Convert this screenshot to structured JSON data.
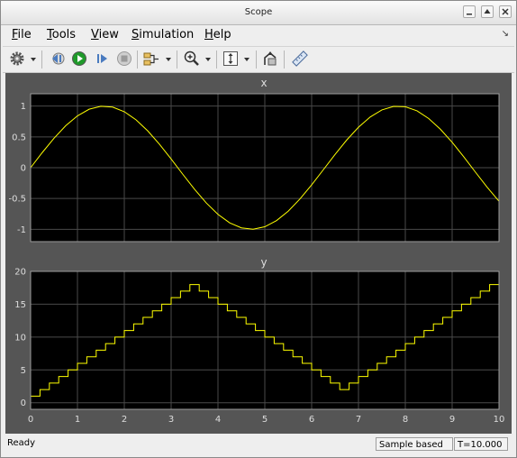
{
  "window": {
    "title": "Scope"
  },
  "menu": {
    "file": {
      "mnemonic": "F",
      "rest": "ile"
    },
    "tools": {
      "mnemonic": "T",
      "rest": "ools"
    },
    "view": {
      "mnemonic": "V",
      "rest": "iew"
    },
    "simulation": {
      "mnemonic": "S",
      "rest": "imulation"
    },
    "help": {
      "mnemonic": "H",
      "rest": "elp"
    }
  },
  "toolbar": {
    "icons": [
      "settings-gear-icon",
      "step-back-icon",
      "run-icon",
      "step-forward-icon",
      "stop-icon",
      "signal-selection-icon",
      "zoom-in-icon",
      "scale-axes-icon",
      "highlight-simulink-block-icon",
      "measurements-icon"
    ],
    "run_color": "#1f9a2a",
    "stop_color": "#9a9a9a"
  },
  "status": {
    "text": "Ready",
    "mode": "Sample based",
    "time": "T=10.000"
  },
  "chart_data": [
    {
      "type": "line",
      "title": "x",
      "x_ticks": [
        "0",
        "1",
        "2",
        "3",
        "4",
        "5",
        "6",
        "7",
        "8",
        "9",
        "10"
      ],
      "y_ticks": [
        "-1",
        "-0.5",
        "0",
        "0.5",
        "1"
      ],
      "xlim": [
        0,
        10
      ],
      "ylim": [
        -1.2,
        1.2
      ],
      "grid": true,
      "background": "#000000",
      "series": [
        {
          "color": "#ffff00",
          "x": [
            0,
            0.25,
            0.5,
            0.75,
            1,
            1.25,
            1.5,
            1.75,
            2,
            2.25,
            2.5,
            2.75,
            3,
            3.25,
            3.5,
            3.75,
            4,
            4.25,
            4.5,
            4.75,
            5,
            5.25,
            5.5,
            5.75,
            6,
            6.25,
            6.5,
            6.75,
            7,
            7.25,
            7.5,
            7.75,
            8,
            8.25,
            8.5,
            8.75,
            9,
            9.25,
            9.5,
            9.75,
            10
          ],
          "y": [
            0,
            0.247,
            0.479,
            0.682,
            0.841,
            0.949,
            0.997,
            0.984,
            0.909,
            0.778,
            0.598,
            0.382,
            0.141,
            -0.108,
            -0.351,
            -0.572,
            -0.757,
            -0.895,
            -0.977,
            -0.999,
            -0.959,
            -0.859,
            -0.706,
            -0.508,
            -0.279,
            -0.033,
            0.215,
            0.45,
            0.657,
            0.823,
            0.938,
            0.995,
            0.989,
            0.923,
            0.798,
            0.624,
            0.412,
            0.174,
            -0.075,
            -0.319,
            -0.544
          ]
        }
      ]
    },
    {
      "type": "line",
      "title": "y",
      "x_ticks": [
        "0",
        "1",
        "2",
        "3",
        "4",
        "5",
        "6",
        "7",
        "8",
        "9",
        "10"
      ],
      "y_ticks": [
        "0",
        "5",
        "10",
        "15",
        "20"
      ],
      "xlim": [
        0,
        10
      ],
      "ylim": [
        -1,
        20
      ],
      "grid": true,
      "background": "#000000",
      "series": [
        {
          "color": "#ffff00",
          "step": true,
          "x": [
            0,
            0.2,
            0.4,
            0.6,
            0.8,
            1,
            1.2,
            1.4,
            1.6,
            1.8,
            2,
            2.2,
            2.4,
            2.6,
            2.8,
            3,
            3.2,
            3.4,
            3.6,
            3.8,
            4,
            4.2,
            4.4,
            4.6,
            4.8,
            5,
            5.2,
            5.4,
            5.6,
            5.8,
            6,
            6.2,
            6.4,
            6.6,
            6.8,
            7,
            7.2,
            7.4,
            7.6,
            7.8,
            8,
            8.2,
            8.4,
            8.6,
            8.8,
            9,
            9.2,
            9.4,
            9.6,
            9.8,
            10
          ],
          "y": [
            1,
            2,
            3,
            4,
            5,
            6,
            7,
            8,
            9,
            10,
            11,
            12,
            13,
            14,
            15,
            16,
            17,
            18,
            17,
            16,
            15,
            14,
            13,
            12,
            11,
            10,
            9,
            8,
            7,
            6,
            5,
            4,
            3,
            2,
            3,
            4,
            5,
            6,
            7,
            8,
            9,
            10,
            11,
            12,
            13,
            14,
            15,
            16,
            17,
            18,
            18
          ]
        }
      ]
    }
  ]
}
